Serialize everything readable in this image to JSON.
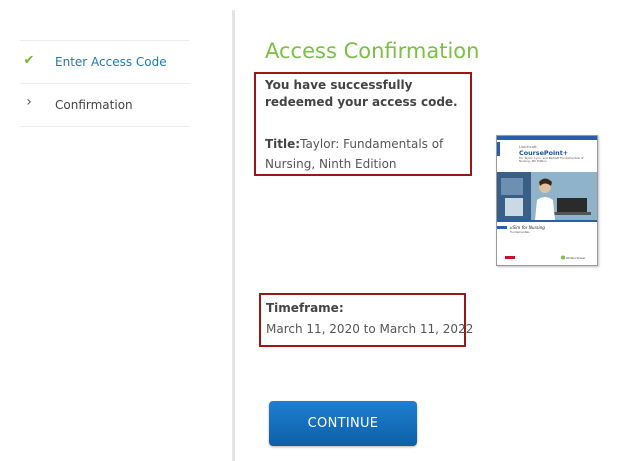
{
  "sidebar": {
    "steps": [
      {
        "label": "Enter Access Code",
        "state": "completed",
        "icon": "check-icon"
      },
      {
        "label": "Confirmation",
        "state": "current",
        "icon": "chevron-right-icon"
      }
    ]
  },
  "main": {
    "title": "Access Confirmation",
    "message": "You have successfully redeemed your access code.",
    "book_title_label": "Title:",
    "book_title": "Taylor: Fundamentals of Nursing, Ninth Edition",
    "cover": {
      "brand_small": "Lippincott",
      "product": "CoursePoint+",
      "subtitle": "For Taylor, Lynn, and Bartlett Fundamentals of Nursing, 9th Edition",
      "sim_line": "vSim for Nursing",
      "sim_sub": "Fundamentals",
      "publisher": "Wolters Kluwer"
    },
    "timeframe_label": "Timeframe:",
    "timeframe_value": "March 11, 2020 to March 11, 2022",
    "continue_label": "CONTINUE"
  },
  "colors": {
    "title_green": "#7ac143",
    "link_blue": "#1a7ab8",
    "highlight_border": "#9a1717",
    "button_blue": "#1473c4"
  }
}
